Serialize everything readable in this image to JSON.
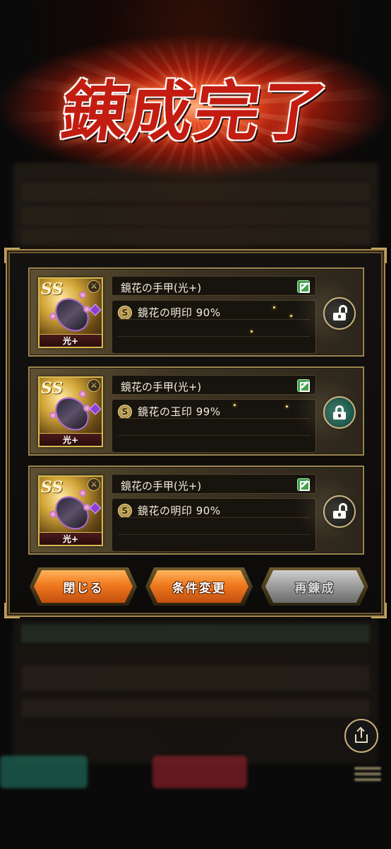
{
  "title": "錬成完了",
  "items": [
    {
      "name": "鏡花の手甲(光+)",
      "element": "光+",
      "effect": "鏡花の明印 90%",
      "lock_state": "unlocked"
    },
    {
      "name": "鏡花の手甲(光+)",
      "element": "光+",
      "effect": "鏡花の玉印 99%",
      "lock_state": "locked"
    },
    {
      "name": "鏡花の手甲(光+)",
      "element": "光+",
      "effect": "鏡花の明印 90%",
      "lock_state": "unlocked"
    }
  ],
  "buttons": {
    "close": "閉じる",
    "change_conditions": "条件変更",
    "re_refine": "再錬成"
  },
  "icons": {
    "edit": "edit-icon",
    "lock": "padlock-icon",
    "share": "share-icon",
    "menu": "hamburger-menu-icon"
  },
  "colors": {
    "accent_gold": "#a88a4e",
    "button_orange": "#f0791e",
    "button_gray": "#9a9a9a",
    "locked_teal": "#2b7a6a",
    "title_red": "#c31d12"
  }
}
